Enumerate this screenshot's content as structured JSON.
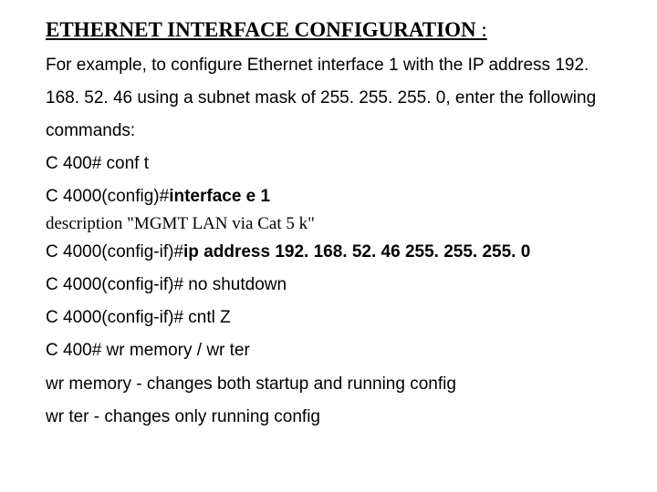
{
  "heading": "ETHERNET INTERFACE CONFIGURATION",
  "heading_suffix": " :",
  "intro": "For example, to configure Ethernet interface 1 with the IP address 192. 168. 52. 46 using a subnet mask of 255. 255. 255. 0, enter the following commands:",
  "commands": {
    "line1": "C 400# conf t",
    "line2a": "C 4000(config)#",
    "line2b": "interface e 1",
    "line3": "description \"MGMT LAN via Cat 5 k\"",
    "line4a": "C 4000(config-if)#",
    "line4b": "ip address 192. 168. 52. 46 255. 255. 255. 0",
    "line5": "C 4000(config-if)# no shutdown",
    "line6": "C 4000(config-if)# cntl Z",
    "line7": "C 400# wr memory  / wr ter"
  },
  "notes": {
    "n1": "wr memory - changes both startup and running config",
    "n2": "wr ter  - changes only running config"
  }
}
